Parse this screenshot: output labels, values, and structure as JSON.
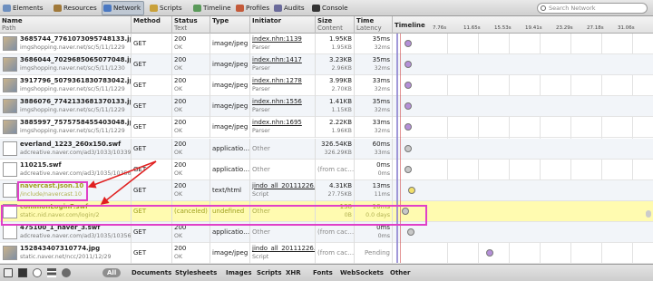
{
  "toolbar": {
    "tabs": [
      {
        "label": "Elements",
        "icon": "elements-icon",
        "color": "#6d8fbf"
      },
      {
        "label": "Resources",
        "icon": "resources-icon",
        "color": "#a0793a"
      },
      {
        "label": "Network",
        "icon": "network-icon",
        "color": "#4a78c2",
        "active": true
      },
      {
        "label": "Scripts",
        "icon": "scripts-icon",
        "color": "#c9a13a"
      },
      {
        "label": "Timeline",
        "icon": "timeline-icon",
        "color": "#5a9a5a"
      },
      {
        "label": "Profiles",
        "icon": "profiles-icon",
        "color": "#c45a3a"
      },
      {
        "label": "Audits",
        "icon": "audits-icon",
        "color": "#6a6a9a"
      },
      {
        "label": "Console",
        "icon": "console-icon",
        "color": "#333333"
      }
    ],
    "search_placeholder": "Search Network"
  },
  "columns": {
    "name": "Name",
    "name_sub": "Path",
    "method": "Method",
    "status": "Status",
    "status_sub": "Text",
    "type": "Type",
    "initiator": "Initiator",
    "size": "Size",
    "size_sub": "Content",
    "time": "Time",
    "time_sub": "Latency",
    "timeline": "Timeline"
  },
  "ticks": [
    "7.76s",
    "11.65s",
    "15.53s",
    "19.41s",
    "23.29s",
    "27.18s",
    "31.06s"
  ],
  "rows": [
    {
      "name": "3685744_7761073095748133.jpg",
      "path": "imgshopping.naver.net/sc/5/11/1229",
      "method": "GET",
      "status": "200",
      "status_text": "OK",
      "type": "image/jpeg",
      "initiator": "index.nhn:1139",
      "initiator_sub": "Parser",
      "size": "1.95KB",
      "content": "1.95KB",
      "time": "35ms",
      "latency": "32ms",
      "dot_color": "#b48fd8"
    },
    {
      "name": "3686044_7029685065077048.jpg",
      "path": "imgshopping.naver.net/sc/5/11/1230",
      "method": "GET",
      "status": "200",
      "status_text": "OK",
      "type": "image/jpeg",
      "initiator": "index.nhn:1417",
      "initiator_sub": "Parser",
      "size": "3.23KB",
      "content": "2.96KB",
      "time": "35ms",
      "latency": "32ms",
      "dot_color": "#b48fd8"
    },
    {
      "name": "3917796_5079361830783042.jpg",
      "path": "imgshopping.naver.net/sc/5/11/1229",
      "method": "GET",
      "status": "200",
      "status_text": "OK",
      "type": "image/jpeg",
      "initiator": "index.nhn:1278",
      "initiator_sub": "Parser",
      "size": "3.99KB",
      "content": "2.70KB",
      "time": "33ms",
      "latency": "32ms",
      "dot_color": "#b48fd8"
    },
    {
      "name": "3886076_7742133681370133.jpg",
      "path": "imgshopping.naver.net/sc/5/11/1229",
      "method": "GET",
      "status": "200",
      "status_text": "OK",
      "type": "image/jpeg",
      "initiator": "index.nhn:1556",
      "initiator_sub": "Parser",
      "size": "1.41KB",
      "content": "1.15KB",
      "time": "35ms",
      "latency": "32ms",
      "dot_color": "#b48fd8"
    },
    {
      "name": "3885997_7575758455403048.jpg",
      "path": "imgshopping.naver.net/sc/5/11/1229",
      "method": "GET",
      "status": "200",
      "status_text": "OK",
      "type": "image/jpeg",
      "initiator": "index.nhn:1695",
      "initiator_sub": "Parser",
      "size": "2.22KB",
      "content": "1.96KB",
      "time": "33ms",
      "latency": "32ms",
      "dot_color": "#b48fd8"
    },
    {
      "name": "everland_1223_260x150.swf",
      "path": "adcreative.naver.com/ad3/1033/10339",
      "method": "GET",
      "status": "200",
      "status_text": "OK",
      "type": "applicatio…",
      "initiator": "Other",
      "initiator_sub": "",
      "size": "326.54KB",
      "content": "326.29KB",
      "time": "60ms",
      "latency": "33ms",
      "dot_color": "#c8c8c8"
    },
    {
      "name": "110215.swf",
      "path": "adcreative.naver.com/ad3/1035/10356",
      "method": "GET",
      "status": "200",
      "status_text": "OK",
      "type": "applicatio…",
      "initiator": "Other",
      "initiator_sub": "",
      "size": "(from cac…",
      "content": "",
      "time": "0ms",
      "latency": "0ms",
      "dot_color": "#c8c8c8"
    },
    {
      "name": "navercast.json.10",
      "path": "/include/navercast.10",
      "method": "GET",
      "status": "200",
      "status_text": "OK",
      "type": "text/html",
      "initiator": "jindo_all_20111226.min",
      "initiator_sub": "Script",
      "size": "4.31KB",
      "content": "27.75KB",
      "time": "13ms",
      "latency": "11ms",
      "dot_color": "#f2e06a"
    },
    {
      "name": "commonLoginF.swf",
      "path": "static.nid.naver.com/login/2",
      "method": "GET",
      "status": "(canceled)",
      "status_text": "",
      "type": "undefined",
      "initiator": "Other",
      "initiator_sub": "",
      "size": "138",
      "content": "0B",
      "time": "10ms",
      "latency": "0.0 days",
      "dot_color": "#c8c8c8"
    },
    {
      "name": "475100_1_naver_3.swf",
      "path": "adcreative.naver.com/ad3/1035/10356",
      "method": "GET",
      "status": "200",
      "status_text": "OK",
      "type": "applicatio…",
      "initiator": "Other",
      "initiator_sub": "",
      "size": "(from cac…",
      "content": "",
      "time": "0ms",
      "latency": "0ms",
      "dot_color": "#c8c8c8"
    },
    {
      "name": "152843407310774.jpg",
      "path": "static.naver.net/ncc/2011/12/29",
      "method": "GET",
      "status": "200",
      "status_text": "OK",
      "type": "image/jpeg",
      "initiator": "jindo_all_20111226.min",
      "initiator_sub": "Script",
      "size": "(from cac…",
      "content": "",
      "time": "Pending",
      "latency": "",
      "dot_color": "#b48fd8"
    }
  ],
  "bottom": {
    "filters": [
      "All",
      "Documents",
      "Stylesheets",
      "Images",
      "Scripts",
      "XHR",
      "Fonts",
      "WebSockets",
      "Other"
    ],
    "selected": "All",
    "icons": [
      "dock-icon",
      "console-toggle-icon",
      "clear-icon",
      "large-rows-icon",
      "record-icon"
    ]
  }
}
